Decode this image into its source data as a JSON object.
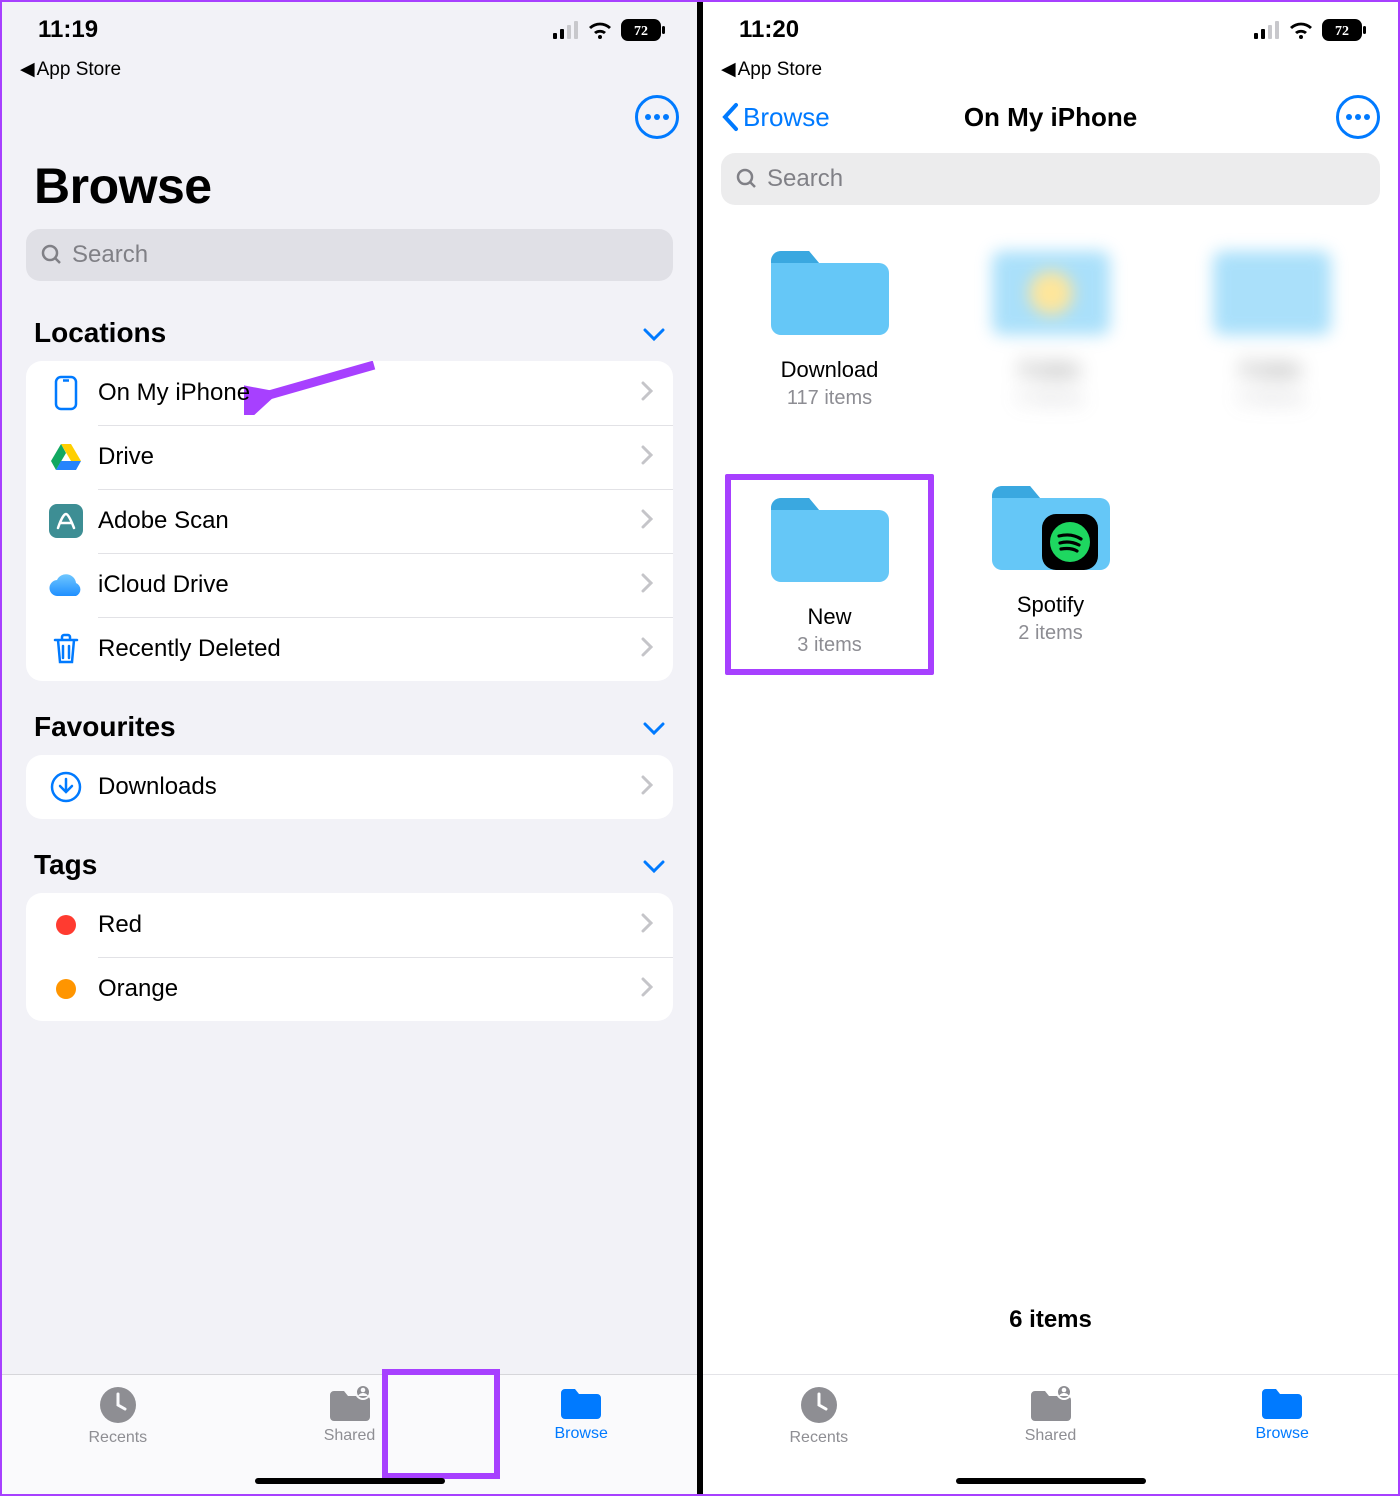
{
  "left": {
    "status": {
      "time": "11:19",
      "backto": "App Store",
      "battery": "72"
    },
    "title": "Browse",
    "search_placeholder": "Search",
    "sections": {
      "locations": {
        "title": "Locations",
        "items": [
          {
            "id": "on-my-iphone",
            "label": "On My iPhone"
          },
          {
            "id": "drive",
            "label": "Drive"
          },
          {
            "id": "adobe-scan",
            "label": "Adobe Scan"
          },
          {
            "id": "icloud-drive",
            "label": "iCloud Drive"
          },
          {
            "id": "recently-deleted",
            "label": "Recently Deleted"
          }
        ]
      },
      "favourites": {
        "title": "Favourites",
        "items": [
          {
            "id": "downloads",
            "label": "Downloads"
          }
        ]
      },
      "tags": {
        "title": "Tags",
        "items": [
          {
            "id": "red",
            "label": "Red",
            "color": "#ff3b30"
          },
          {
            "id": "orange",
            "label": "Orange",
            "color": "#ff9500"
          }
        ]
      }
    },
    "tabs": {
      "recents": "Recents",
      "shared": "Shared",
      "browse": "Browse"
    }
  },
  "right": {
    "status": {
      "time": "11:20",
      "backto": "App Store",
      "battery": "72"
    },
    "back_label": "Browse",
    "title": "On My iPhone",
    "search_placeholder": "Search",
    "folders": [
      {
        "id": "download",
        "name": "Download",
        "count": "117 items",
        "blurred": false
      },
      {
        "id": "blur1",
        "name": "",
        "count": "",
        "blurred": true
      },
      {
        "id": "blur2",
        "name": "",
        "count": "",
        "blurred": true
      },
      {
        "id": "new",
        "name": "New",
        "count": "3 items",
        "blurred": false,
        "highlighted": true
      },
      {
        "id": "spotify",
        "name": "Spotify",
        "count": "2 items",
        "blurred": false,
        "badge": "spotify"
      }
    ],
    "summary": "6 items",
    "tabs": {
      "recents": "Recents",
      "shared": "Shared",
      "browse": "Browse"
    }
  }
}
